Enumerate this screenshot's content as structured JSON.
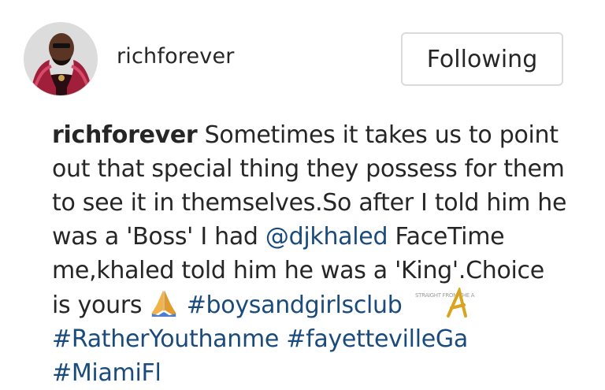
{
  "post_header": {
    "username": "richforever",
    "follow_button_label": "Following"
  },
  "caption": {
    "username": "richforever",
    "line1_text": " Sometimes it takes us to point",
    "line2_text": "out that special thing they possess for them",
    "line3_text": "to see it in themselves.So after I told him he",
    "line4_text_before": "was a 'Boss' I had ",
    "mention": "@djkhaled",
    "line4_text_after": " FaceTime",
    "line5_text": "me,khaled told him he was a 'King'.Choice",
    "line6_text": "is yours ",
    "emoji": "folded-hands-emoji",
    "hashtags": [
      "#boysandgirlsclub",
      "#RatherYouthanme",
      "#fayettevilleGa",
      "#MiamiFl"
    ]
  },
  "watermark": {
    "logo": "straight-from-the-a-logo",
    "text": "STRAIGHT FROM THE A"
  },
  "colors": {
    "text": "#262626",
    "link": "#1a4b7c",
    "button_border": "#dbdbdb",
    "background": "#ffffff"
  }
}
